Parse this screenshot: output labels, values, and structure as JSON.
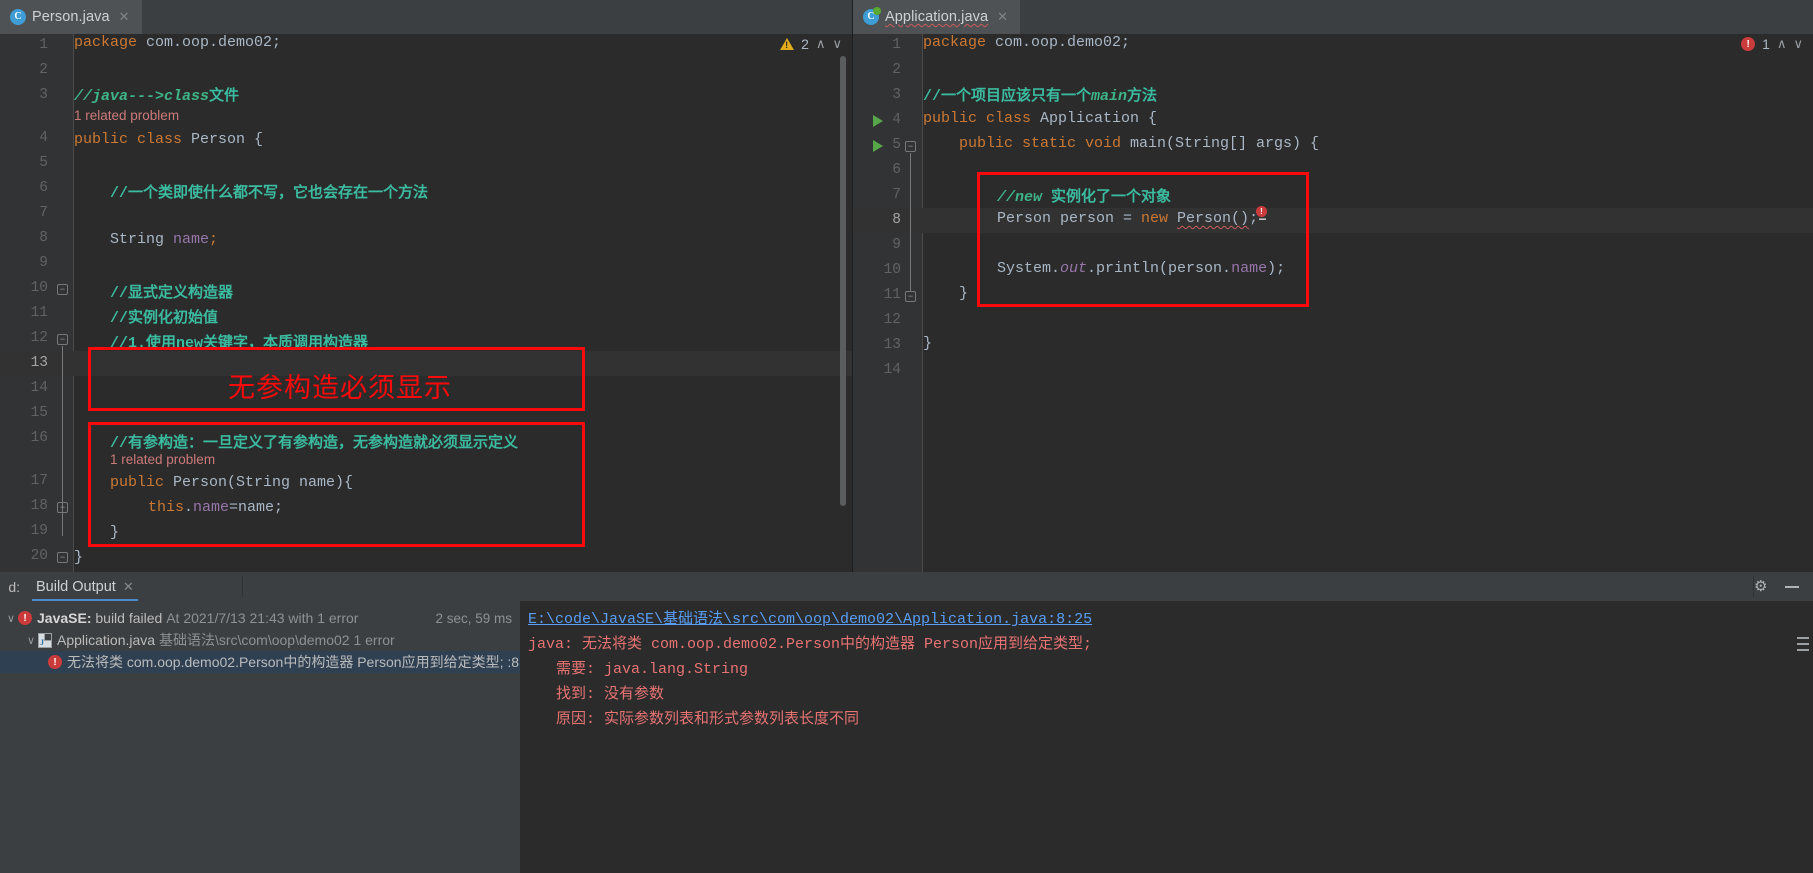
{
  "editors": {
    "left": {
      "tab": {
        "label": "Person.java",
        "icon": "java-class-icon",
        "close": "✕"
      },
      "inspection": {
        "warn_count": "2",
        "up": "∧",
        "down": "∨"
      },
      "line_numbers": [
        "1",
        "2",
        "3",
        "4",
        "5",
        "6",
        "7",
        "8",
        "9",
        "10",
        "11",
        "12",
        "13",
        "14",
        "15",
        "16",
        "17",
        "18",
        "19",
        "20"
      ],
      "code_lines": [
        {
          "n": 1,
          "text": "package com.oop.demo02;"
        },
        {
          "n": 2,
          "text": ""
        },
        {
          "n": 3,
          "text": "//java--->class文件"
        },
        {
          "n": 0,
          "text": "1 related problem"
        },
        {
          "n": 4,
          "text": "public class Person {"
        },
        {
          "n": 5,
          "text": ""
        },
        {
          "n": 6,
          "text": "    //一个类即使什么都不写，它也会存在一个方法"
        },
        {
          "n": 7,
          "text": ""
        },
        {
          "n": 8,
          "text": "    String name;"
        },
        {
          "n": 9,
          "text": ""
        },
        {
          "n": 10,
          "text": "    //显式定义构造器"
        },
        {
          "n": 11,
          "text": "    //实例化初始值"
        },
        {
          "n": 12,
          "text": "    //1.使用new关键字，本质调用构造器"
        },
        {
          "n": 13,
          "text": ""
        },
        {
          "n": 14,
          "text": ""
        },
        {
          "n": 15,
          "text": ""
        },
        {
          "n": 16,
          "text": "    //有参构造：一旦定义了有参构造，无参构造就必须显示定义"
        },
        {
          "n": 0,
          "text": "1 related problem"
        },
        {
          "n": 17,
          "text": "    public Person(String name){"
        },
        {
          "n": 18,
          "text": "        this.name=name;"
        },
        {
          "n": 19,
          "text": "    }"
        },
        {
          "n": 20,
          "text": "}"
        }
      ],
      "annotations": [
        {
          "name": "no-arg-constructor-note",
          "text": "无参构造必须显示"
        },
        {
          "name": "arg-constructor-box",
          "text": ""
        }
      ]
    },
    "right": {
      "tab": {
        "label": "Application.java",
        "icon": "java-class-run-icon",
        "close": "✕"
      },
      "inspection": {
        "err_count": "1",
        "up": "∧",
        "down": "∨"
      },
      "line_numbers": [
        "1",
        "2",
        "3",
        "4",
        "5",
        "6",
        "7",
        "8",
        "9",
        "10",
        "11",
        "12",
        "13",
        "14"
      ],
      "code_lines": [
        {
          "n": 1,
          "text": "package com.oop.demo02;"
        },
        {
          "n": 2,
          "text": ""
        },
        {
          "n": 3,
          "text": "//一个项目应该只有一个main方法"
        },
        {
          "n": 4,
          "text": "public class Application {"
        },
        {
          "n": 5,
          "text": "    public static void main(String[] args) {"
        },
        {
          "n": 6,
          "text": ""
        },
        {
          "n": 7,
          "text": "        //new 实例化了一个对象"
        },
        {
          "n": 8,
          "text": "        Person person = new Person();"
        },
        {
          "n": 9,
          "text": ""
        },
        {
          "n": 10,
          "text": "        System.out.println(person.name);"
        },
        {
          "n": 11,
          "text": "    }"
        },
        {
          "n": 12,
          "text": ""
        },
        {
          "n": 13,
          "text": "}"
        },
        {
          "n": 14,
          "text": ""
        }
      ],
      "annotations": [
        {
          "name": "new-instance-box",
          "text": ""
        }
      ]
    }
  },
  "bottom_panel": {
    "prefix_label": "d:",
    "tab": {
      "label": "Build Output",
      "close": "✕"
    },
    "icons": {
      "settings": "gear-icon",
      "minimize": "minimize-icon"
    },
    "tree": [
      {
        "name": "build-result-row",
        "chevron": "∨",
        "icon": "error-icon",
        "title": "JavaSE:",
        "status": "build failed",
        "detail": "At 2021/7/13 21:43 with 1 error",
        "time": "2 sec, 59 ms",
        "indent": 0,
        "selected": false
      },
      {
        "name": "file-row",
        "chevron": "∨",
        "icon": "java-file-icon",
        "title": "Application.java",
        "status": "",
        "detail": "基础语法\\src\\com\\oop\\demo02  1 error",
        "time": "",
        "indent": 1,
        "selected": false
      },
      {
        "name": "error-row",
        "chevron": "",
        "icon": "error-icon",
        "title": "",
        "status": "",
        "detail": "无法将类 com.oop.demo02.Person中的构造器 Person应用到给定类型; :8",
        "time": "",
        "indent": 2,
        "selected": true
      }
    ],
    "messages": [
      {
        "name": "error-file-link",
        "text": "E:\\code\\JavaSE\\基础语法\\src\\com\\oop\\demo02\\Application.java:8:25",
        "link": true,
        "indent": 0
      },
      {
        "name": "error-summary",
        "text": "java: 无法将类 com.oop.demo02.Person中的构造器 Person应用到给定类型;",
        "link": false,
        "indent": 0
      },
      {
        "name": "error-required",
        "text": "需要: java.lang.String",
        "link": false,
        "indent": 1
      },
      {
        "name": "error-found",
        "text": "找到: 没有参数",
        "link": false,
        "indent": 1
      },
      {
        "name": "error-reason",
        "text": "原因: 实际参数列表和形式参数列表长度不同",
        "link": false,
        "indent": 1
      }
    ]
  },
  "colors": {
    "bg": "#2b2b2b",
    "panel": "#3c3f41",
    "gutter": "#313335",
    "annotation_red": "#fa0a0a",
    "comment_green": "#3eb489",
    "keyword_orange": "#cc7832",
    "field_purple": "#9876aa",
    "link_blue": "#589df6",
    "error_red": "#cc3b3b",
    "warn_yellow": "#e0ac1c"
  }
}
